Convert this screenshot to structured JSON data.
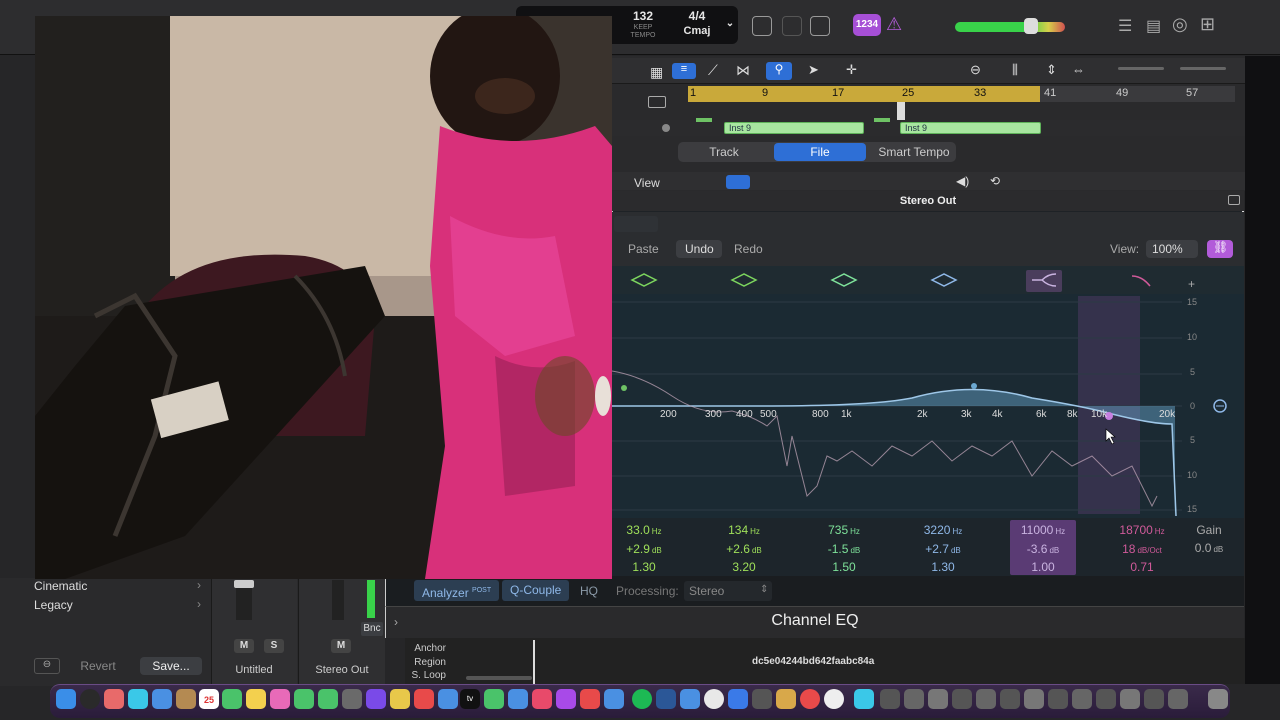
{
  "transport": {
    "bpm": "132",
    "bpm_sub": "KEEP",
    "tempo_label": "TEMPO",
    "signature": "4/4",
    "key": "Cmaj",
    "count_in_badge": "1234"
  },
  "arrange": {
    "ruler": [
      "1",
      "9",
      "17",
      "25",
      "33",
      "41",
      "49",
      "57"
    ],
    "regions": [
      {
        "label": "Inst 9"
      },
      {
        "label": "Inst 9"
      }
    ],
    "tabs": [
      {
        "label": "Track",
        "active": false
      },
      {
        "label": "File",
        "active": true
      },
      {
        "label": "Smart Tempo",
        "active": false
      }
    ],
    "view_menu": "View"
  },
  "plugin": {
    "window_title": "Stereo Out",
    "toolbar": {
      "paste": "Paste",
      "undo": "Undo",
      "redo": "Redo",
      "view_label": "View:",
      "zoom": "100%"
    },
    "freq_labels": [
      "200",
      "300",
      "400",
      "500",
      "800",
      "1k",
      "2k",
      "3k",
      "4k",
      "6k",
      "8k",
      "10k",
      "20k"
    ],
    "db_labels": [
      "15",
      "10",
      "5",
      "0",
      "5",
      "10",
      "15"
    ],
    "bands": [
      {
        "freq": "33.0",
        "freq_unit": "Hz",
        "gain": "+2.9",
        "gain_unit": "dB",
        "q": "1.30",
        "color": "#9fe05a"
      },
      {
        "freq": "134",
        "freq_unit": "Hz",
        "gain": "+2.6",
        "gain_unit": "dB",
        "q": "3.20",
        "color": "#9fe05a"
      },
      {
        "freq": "735",
        "freq_unit": "Hz",
        "gain": "-1.5",
        "gain_unit": "dB",
        "q": "1.50",
        "color": "#7ee29a"
      },
      {
        "freq": "3220",
        "freq_unit": "Hz",
        "gain": "+2.7",
        "gain_unit": "dB",
        "q": "1.30",
        "color": "#8fb8e8"
      },
      {
        "freq": "11000",
        "freq_unit": "Hz",
        "gain": "-3.6",
        "gain_unit": "dB",
        "q": "1.00",
        "color": "#c9b3e0"
      },
      {
        "freq": "18700",
        "freq_unit": "Hz",
        "gain": "18",
        "gain_unit": "dB/Oct",
        "q": "0.71",
        "color": "#d05a9a"
      }
    ],
    "gain_label": "Gain",
    "gain_value": "0.0",
    "gain_unit": "dB",
    "bottom": {
      "analyzer": "Analyzer",
      "analyzer_sup": "POST",
      "q_couple": "Q-Couple",
      "hq": "HQ",
      "processing_label": "Processing:",
      "processing_value": "Stereo"
    },
    "footer_title": "Channel EQ"
  },
  "library": {
    "items": [
      "Cinematic",
      "Legacy"
    ],
    "revert": "Revert",
    "save": "Save..."
  },
  "mixer": {
    "strips": [
      {
        "name": "Untitled",
        "m": "M",
        "s": "S"
      },
      {
        "name": "Stereo Out",
        "m": "M",
        "tag": "Bnc"
      }
    ]
  },
  "bottom_strip": {
    "anchor": "Anchor",
    "region": "Region",
    "sloop": "S. Loop",
    "hash": "dc5e04244bd642faabc84a"
  },
  "dock": {
    "calendar_day": "25"
  }
}
